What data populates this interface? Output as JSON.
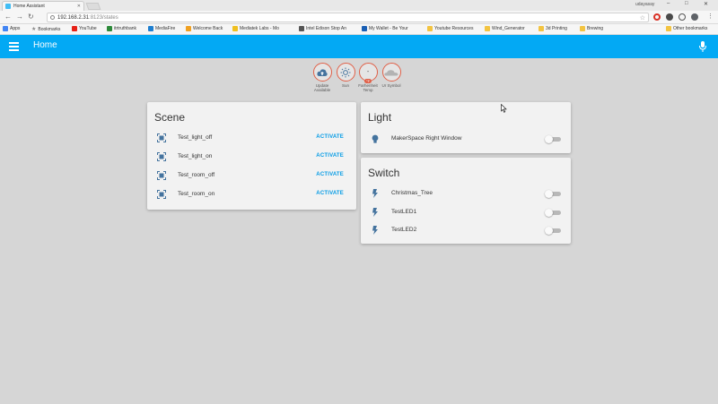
{
  "browser": {
    "tab_title": "Home Assistant",
    "profile_name": "udayasay",
    "url_host": "192.168.2.31",
    "url_rest": ":8123/states",
    "window_controls": [
      "–",
      "□",
      "✕"
    ]
  },
  "bookmarks": [
    {
      "label": "Apps",
      "icon": "apps-icon",
      "color": "#4285f4"
    },
    {
      "label": "Bookmarks",
      "icon": "star-icon",
      "color": "#888888"
    },
    {
      "label": "YouTube",
      "icon": "youtube-icon",
      "color": "#e62117"
    },
    {
      "label": "itrtruthbank",
      "icon": "page-icon",
      "color": "#2d8a3a"
    },
    {
      "label": "MediaFire",
      "icon": "page-icon",
      "color": "#1e7fd0"
    },
    {
      "label": "Welcome Back",
      "icon": "page-icon",
      "color": "#f0a020"
    },
    {
      "label": "Mediatek Labs - Mo",
      "icon": "page-icon",
      "color": "#f0c020"
    },
    {
      "label": "Intel Edison Stop An",
      "icon": "page-icon",
      "color": "#555555"
    },
    {
      "label": "My Wallet - Be Your",
      "icon": "page-icon",
      "color": "#1a5fb4"
    },
    {
      "label": "Youtube Resources",
      "icon": "folder-icon",
      "color": "#f3c441"
    },
    {
      "label": "Wind_Generator",
      "icon": "folder-icon",
      "color": "#f3c441"
    },
    {
      "label": "3d Printing",
      "icon": "folder-icon",
      "color": "#f3c441"
    },
    {
      "label": "Brewing",
      "icon": "folder-icon",
      "color": "#f3c441"
    },
    {
      "label": "Other bookmarks",
      "icon": "folder-icon",
      "color": "#f3c441"
    }
  ],
  "header": {
    "title": "Home",
    "bg_color": "#03a9f4"
  },
  "badges": [
    {
      "icon": "cloud-upload-icon",
      "label_line1": "Update",
      "label_line2": "Available",
      "pill": ""
    },
    {
      "icon": "sun-icon",
      "label_line1": "Sun",
      "label_line2": "",
      "pill": ""
    },
    {
      "icon": "thermometer-icon",
      "label_line1": "Farhenheit",
      "label_line2": "Temp",
      "pill": "°F",
      "value": "-"
    },
    {
      "icon": "weather-cloud-icon",
      "label_line1": "Ur Symbol",
      "label_line2": "",
      "pill": ""
    }
  ],
  "scene_card": {
    "title": "Scene",
    "action_label": "ACTIVATE",
    "rows": [
      {
        "label": "Test_light_off"
      },
      {
        "label": "Test_light_on"
      },
      {
        "label": "Test_room_off"
      },
      {
        "label": "Test_room_on"
      }
    ]
  },
  "light_card": {
    "title": "Light",
    "rows": [
      {
        "label": "MakerSpace Right Window",
        "state": "off"
      }
    ]
  },
  "switch_card": {
    "title": "Switch",
    "rows": [
      {
        "label": "Christmas_Tree",
        "state": "off"
      },
      {
        "label": "TestLED1",
        "state": "off"
      },
      {
        "label": "TestLED2",
        "state": "off"
      }
    ]
  },
  "colors": {
    "accent": "#039be5",
    "badge_ring": "#e06048",
    "icon": "#44739e",
    "background": "#d6d6d6"
  }
}
